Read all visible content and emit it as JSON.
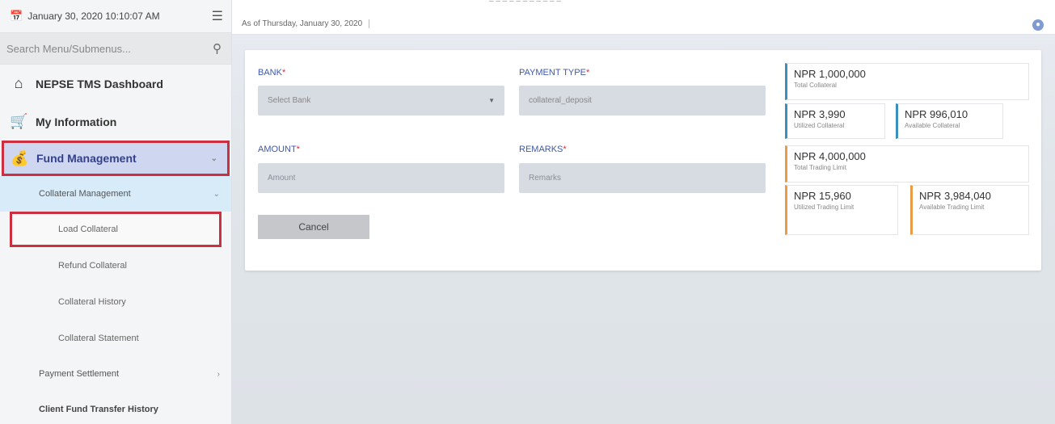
{
  "header": {
    "datetime": "January 30, 2020 10:10:07 AM",
    "top_cut_text": "– – – – – – – – – – –",
    "as_of": "As of Thursday, January 30, 2020"
  },
  "search": {
    "placeholder": "Search Menu/Submenus..."
  },
  "nav": {
    "dashboard": "NEPSE TMS Dashboard",
    "my_information": "My Information",
    "fund_management": "Fund Management",
    "collateral_management": "Collateral Management",
    "load_collateral": "Load Collateral",
    "refund_collateral": "Refund Collateral",
    "collateral_history": "Collateral History",
    "collateral_statement": "Collateral Statement",
    "payment_settlement": "Payment Settlement",
    "client_fund_transfer_history": "Client Fund Transfer History"
  },
  "form": {
    "bank_label": "BANK",
    "bank_value": "Select Bank",
    "payment_type_label": "PAYMENT TYPE",
    "payment_type_value": "collateral_deposit",
    "amount_label": "AMOUNT",
    "amount_placeholder": "Amount",
    "remarks_label": "REMARKS",
    "remarks_placeholder": "Remarks",
    "required_mark": "*",
    "cancel_label": "Cancel"
  },
  "stats": {
    "total_collateral": {
      "value": "NPR 1,000,000",
      "label": "Total Collateral"
    },
    "utilized_collateral": {
      "value": "NPR 3,990",
      "label": "Utilized Collateral"
    },
    "available_collateral": {
      "value": "NPR 996,010",
      "label": "Available Collateral"
    },
    "total_trading_limit": {
      "value": "NPR 4,000,000",
      "label": "Total Trading Limit"
    },
    "utilized_trading_limit": {
      "value": "NPR 15,960",
      "label": "Utilized Trading Limit"
    },
    "available_trading_limit": {
      "value": "NPR 3,984,040",
      "label": "Available Trading Limit"
    }
  },
  "colors": {
    "accent_blue": "#3b8fbd",
    "accent_orange": "#e79c45",
    "highlight_red": "#cc3040",
    "label_blue": "#3f59a8"
  }
}
